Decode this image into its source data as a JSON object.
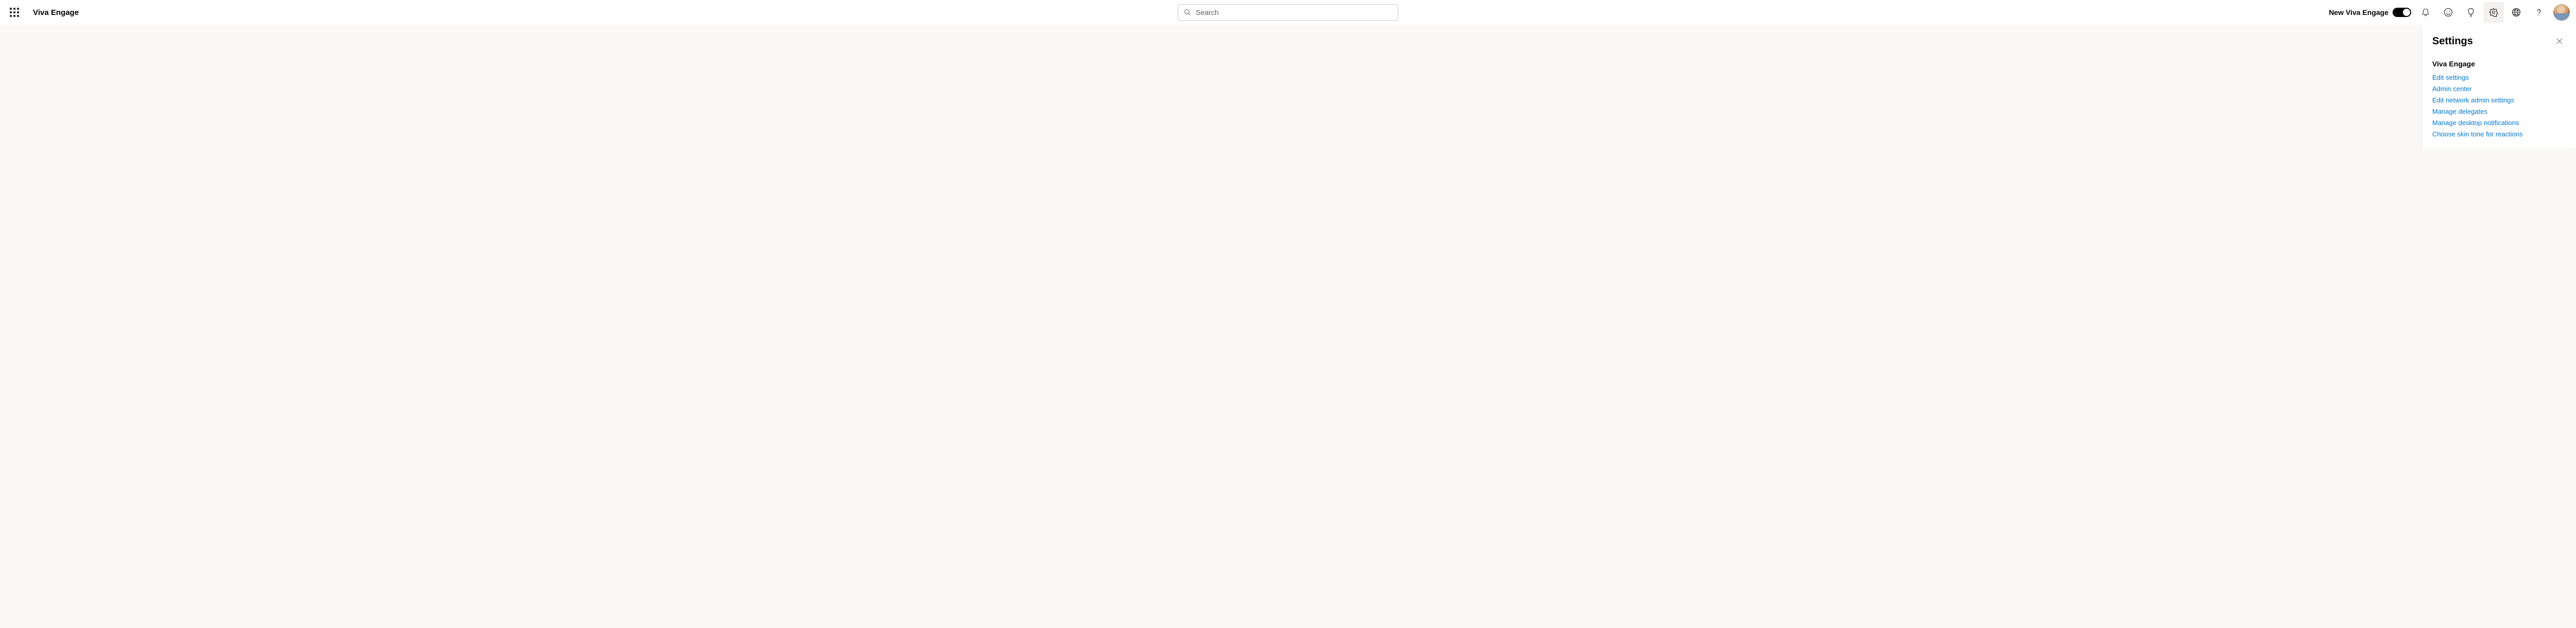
{
  "header": {
    "app_title": "Viva Engage",
    "search_placeholder": "Search",
    "new_toggle_label": "New Viva Engage",
    "toggle_on": true
  },
  "header_icons": {
    "waffle": "app-launcher-icon",
    "bell": "notifications-icon",
    "emoji": "emoji-icon",
    "lightbulb": "ideas-icon",
    "gear": "settings-icon",
    "globe": "globe-icon",
    "help": "help-icon",
    "avatar": "user-avatar"
  },
  "panel": {
    "title": "Settings",
    "section_heading": "Viva Engage",
    "links": [
      "Edit settings",
      "Admin center",
      "Edit network admin settings",
      "Manage delegates",
      "Manage desktop notifications",
      "Choose skin tone for reactions"
    ]
  }
}
